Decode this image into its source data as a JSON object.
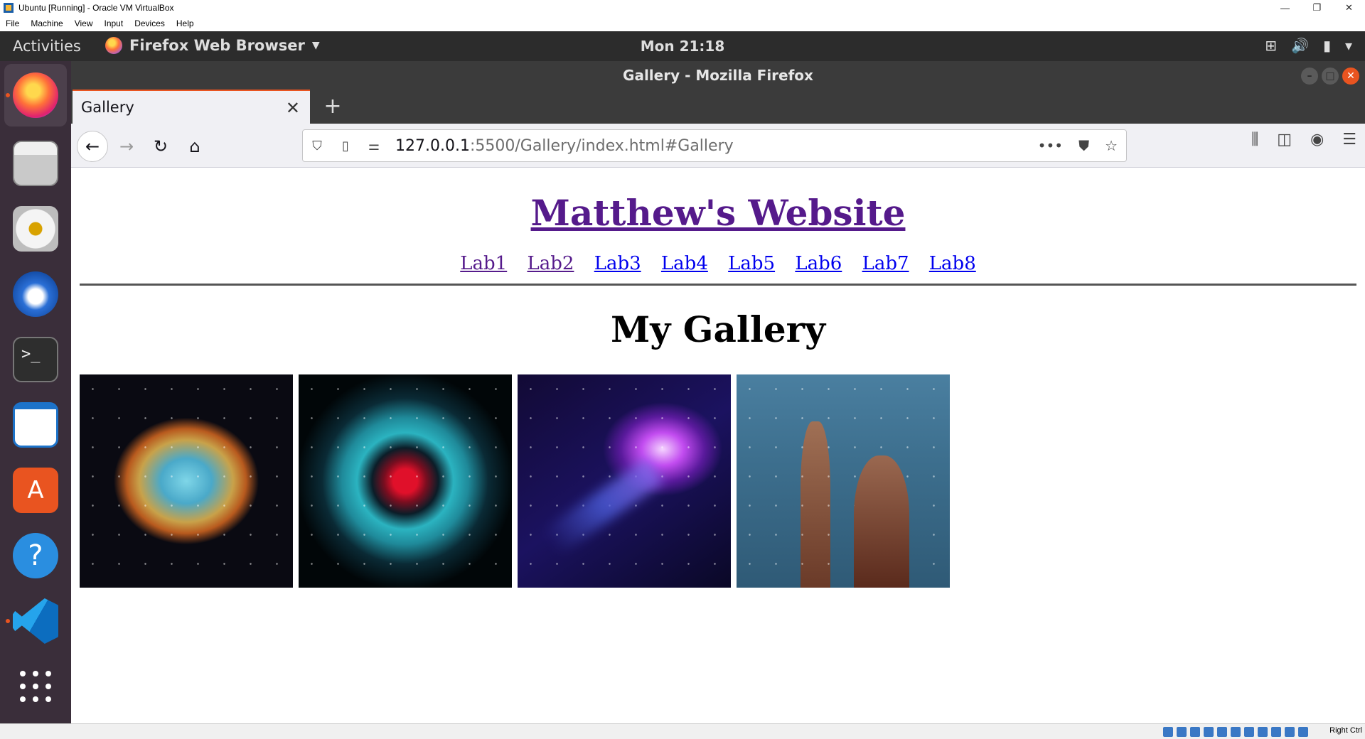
{
  "host_window": {
    "title": "Ubuntu [Running] - Oracle VM VirtualBox",
    "menu": [
      "File",
      "Machine",
      "View",
      "Input",
      "Devices",
      "Help"
    ],
    "controls": {
      "minimize": "—",
      "restore": "❐",
      "close": "✕"
    },
    "status_hostkey": "Right Ctrl"
  },
  "gnome": {
    "activities": "Activities",
    "app_menu": "Firefox Web Browser",
    "clock": "Mon 21:18"
  },
  "firefox": {
    "window_title": "Gallery - Mozilla Firefox",
    "tab_title": "Gallery",
    "url_host": "127.0.0.1",
    "url_rest": ":5500/Gallery/index.html#Gallery"
  },
  "page": {
    "site_title": "Matthew's Website",
    "nav": [
      "Lab1",
      "Lab2",
      "Lab3",
      "Lab4",
      "Lab5",
      "Lab6",
      "Lab7",
      "Lab8"
    ],
    "heading": "My Gallery"
  },
  "colors": {
    "link": "#0000ee",
    "visited": "#551a8b",
    "tab_accent": "#e95420"
  }
}
